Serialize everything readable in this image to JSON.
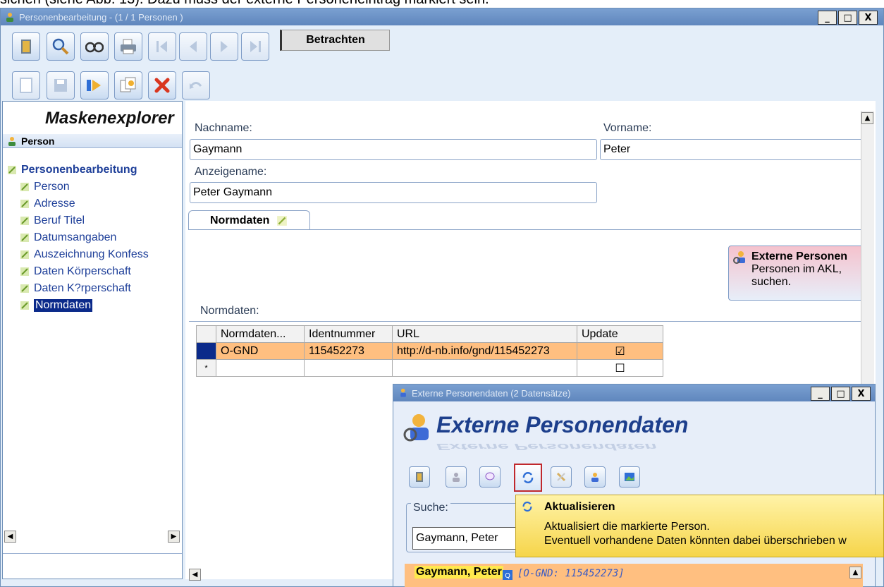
{
  "caption": "sichen (siehe Abb. 13). Dazu muss der externe Personeneintrag markiert sein.",
  "main_window": {
    "title": "Personenbearbeitung - (1 / 1 Personen )",
    "min_label": "_",
    "max_label": "□",
    "close_label": "X",
    "mode_label": "Betrachten"
  },
  "explorer": {
    "title": "Maskenexplorer",
    "header": "Person",
    "root": "Personenbearbeitung",
    "items": [
      "Person",
      "Adresse",
      "Beruf Titel",
      "Datumsangaben",
      "Auszeichnung Konfess",
      "Daten Körperschaft",
      "Daten K?rperschaft",
      "Normdaten"
    ],
    "selected": "Normdaten"
  },
  "form": {
    "nachname_label": "Nachname:",
    "nachname_value": "Gaymann",
    "vorname_label": "Vorname:",
    "vorname_value": "Peter",
    "anzeigename_label": "Anzeigename:",
    "anzeigename_value": "Peter Gaymann",
    "tab_label": "Normdaten",
    "normdaten_label": "Normdaten:",
    "ext_panel_title": "Externe Personen",
    "ext_panel_text_1": "Personen im AKL,",
    "ext_panel_text_2": "suchen."
  },
  "grid": {
    "headers": [
      "Normdaten...",
      "Identnummer",
      "URL",
      "Update"
    ],
    "rows": [
      {
        "normdaten": "O-GND",
        "ident": "115452273",
        "url": "http://d-nb.info/gnd/115452273",
        "update": "☑"
      },
      {
        "marker": "*",
        "normdaten": "",
        "ident": "",
        "url": "",
        "update": "☐"
      }
    ]
  },
  "ext_window": {
    "title": "Externe Personendaten (2 Datensätze)",
    "heading": "Externe Personendaten",
    "search_label": "Suche:",
    "search_value": "Gaymann, Peter",
    "result_name": "Gaymann, Peter",
    "result_gnd": "[O-GND: 115452273]"
  },
  "tooltip": {
    "title": "Aktualisieren",
    "line1": "Aktualisiert die markierte Person.",
    "line2": "Eventuell vorhandene Daten könnten dabei überschrieben w"
  },
  "colors": {
    "selection_orange": "#ffbf80",
    "tooltip_yellow": "#f6d54a",
    "highlight_red": "#c0282d"
  }
}
